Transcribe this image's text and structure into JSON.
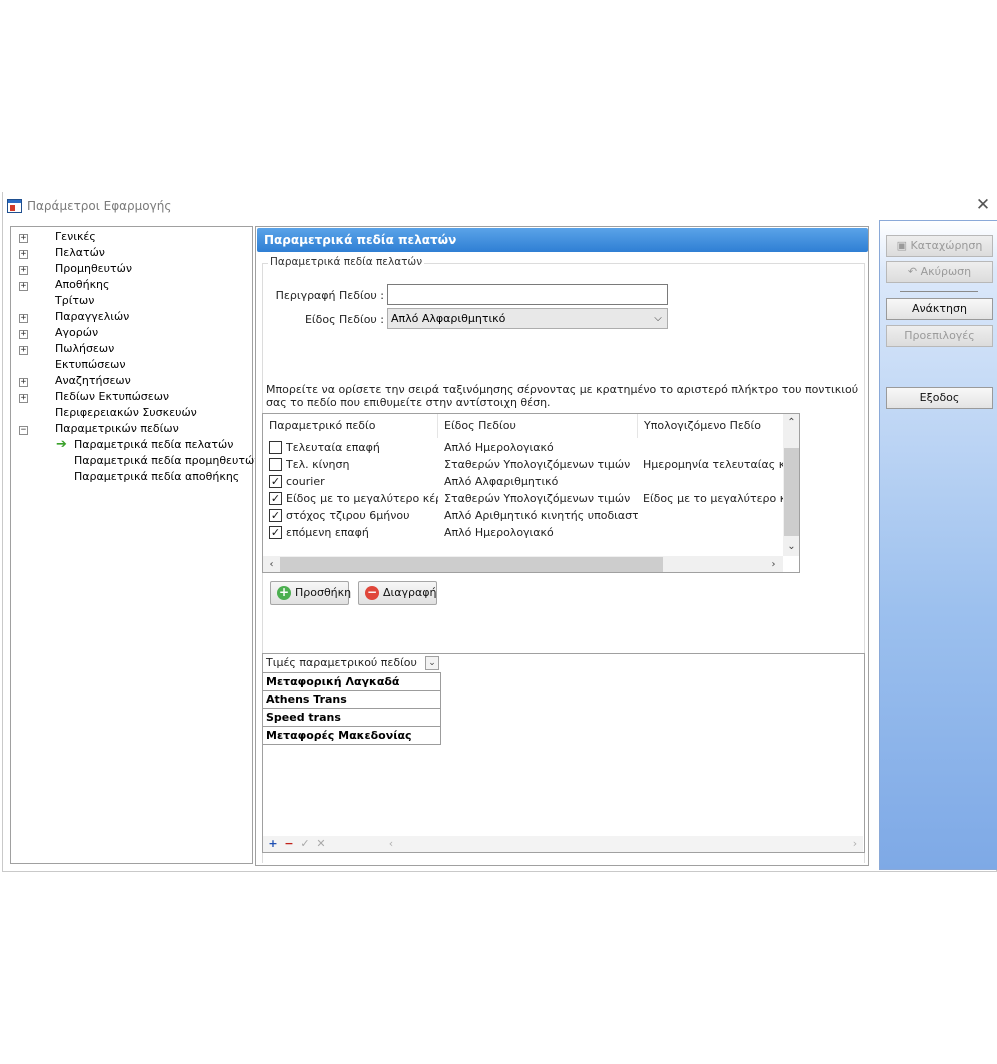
{
  "window": {
    "title": "Παράμετροι Εφαρμογής"
  },
  "tree": {
    "items": [
      {
        "label": "Γενικές",
        "expandable": true
      },
      {
        "label": "Πελατών",
        "expandable": true
      },
      {
        "label": "Προμηθευτών",
        "expandable": true
      },
      {
        "label": "Αποθήκης",
        "expandable": true
      },
      {
        "label": "Τρίτων",
        "expandable": false
      },
      {
        "label": "Παραγγελιών",
        "expandable": true
      },
      {
        "label": "Αγορών",
        "expandable": true
      },
      {
        "label": "Πωλήσεων",
        "expandable": true
      },
      {
        "label": "Εκτυπώσεων",
        "expandable": false
      },
      {
        "label": "Αναζητήσεων",
        "expandable": true
      },
      {
        "label": "Πεδίων Εκτυπώσεων",
        "expandable": true
      },
      {
        "label": "Περιφερειακών Συσκευών",
        "expandable": false
      },
      {
        "label": "Παραμετρικών πεδίων",
        "expandable": true,
        "expanded": true
      }
    ],
    "children": [
      {
        "label": "Παραμετρικά πεδία πελατών",
        "selected": true
      },
      {
        "label": "Παραμετρικά πεδία προμηθευτών"
      },
      {
        "label": "Παραμετρικά πεδία αποθήκης"
      }
    ]
  },
  "main": {
    "header": "Παραμετρικά πεδία πελατών",
    "group_title": "Παραμετρικά πεδία πελατών",
    "description_label": "Περιγραφή Πεδίου :",
    "description_value": "",
    "type_label": "Είδος Πεδίου :",
    "type_value": "Απλό Αλφαριθμητικό",
    "hint": "Μπορείτε να ορίσετε την σειρά ταξινόμησης σέρνοντας με κρατημένο το αριστερό πλήκτρο του ποντικιού σας το πεδίο που επιθυμείτε στην αντίστοιχη θέση.",
    "grid": {
      "columns": [
        "Παραμετρικό πεδίο",
        "Είδος Πεδίου",
        "Υπολογιζόμενο Πεδίο"
      ],
      "rows": [
        {
          "checked": false,
          "name": "Τελευταία επαφή",
          "type": "Απλό Ημερολογιακό",
          "computed": ""
        },
        {
          "checked": false,
          "name": "Τελ. κίνηση",
          "type": "Σταθερών Υπολογιζόμενων τιμών",
          "computed": "Ημερομηνία τελευταίας κίνησ"
        },
        {
          "checked": true,
          "name": "courier",
          "type": "Απλό Αλφαριθμητικό",
          "computed": ""
        },
        {
          "checked": true,
          "name": "Είδος με το μεγαλύτερο κέρδος",
          "type": "Σταθερών Υπολογιζόμενων τιμών",
          "computed": "Είδος με το μεγαλύτερο κέρδ"
        },
        {
          "checked": true,
          "name": "στόχος τζιρου 6μήνου",
          "type": "Απλό Αριθμητικό κινητής υποδιαστολής",
          "computed": ""
        },
        {
          "checked": true,
          "name": "επόμενη επαφή",
          "type": "Απλό Ημερολογιακό",
          "computed": ""
        }
      ]
    },
    "buttons": {
      "add": "Προσθήκη",
      "delete": "Διαγραφή"
    },
    "values": {
      "header": "Τιμές παραμετρικού πεδίου",
      "rows": [
        "Μεταφορική Λαγκαδά",
        "Athens Trans",
        "Speed trans",
        "Μεταφορές Μακεδονίας"
      ]
    }
  },
  "actions": {
    "save": "Καταχώρηση",
    "cancel": "Ακύρωση",
    "refresh": "Ανάκτηση",
    "defaults": "Προεπιλογές",
    "exit": "Εξοδος"
  },
  "icons": [
    "app-icon",
    "close-icon",
    "plus-icon",
    "minus-icon",
    "arrow-right-icon",
    "chevron-down-icon",
    "check-icon",
    "add-icon",
    "delete-icon",
    "save-icon",
    "undo-icon"
  ]
}
